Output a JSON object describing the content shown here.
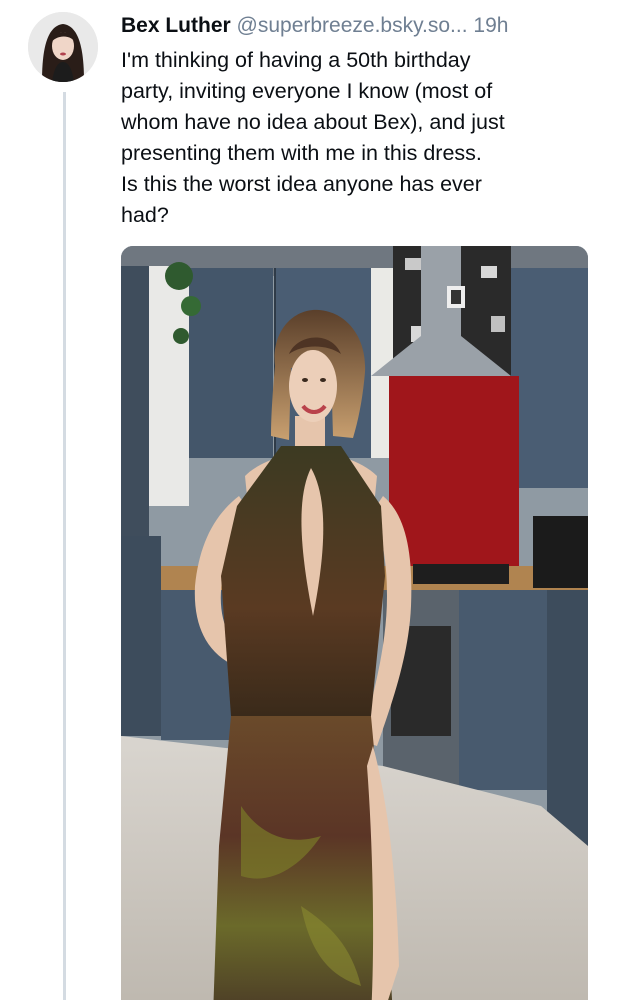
{
  "post": {
    "author": {
      "display_name": "Bex Luther",
      "handle": "@superbreeze.bsky.so...",
      "avatar_icon": "avatar-photo"
    },
    "timestamp": "19h",
    "text_lines": [
      "I'm thinking of having a 50th birthday",
      "party, inviting everyone I know (most of",
      "whom have no idea about Bex), and just",
      "presenting them with me in this dress."
    ],
    "highlighted_lines": [
      "Is this the worst idea anyone has ever",
      "had?"
    ],
    "highlight_color": "#fbf79a",
    "media": {
      "type": "photo",
      "subject": "person-in-long-dress-kitchen-photo"
    }
  },
  "colors": {
    "name": "#0b0f14",
    "meta": "#6f7f92",
    "thread_line": "#d4dbe2"
  }
}
